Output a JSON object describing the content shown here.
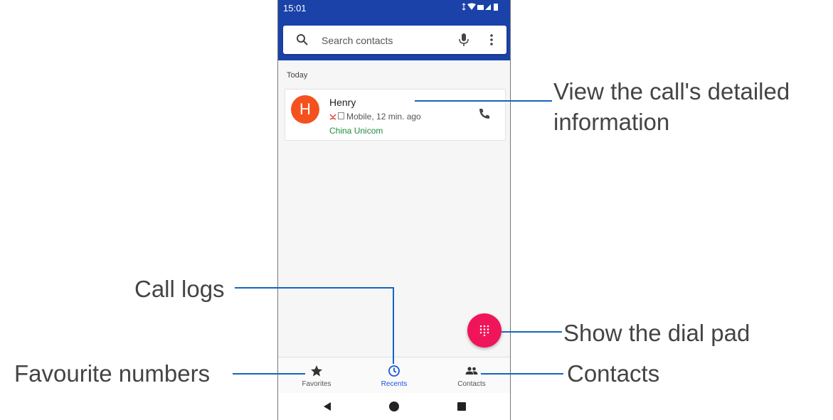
{
  "status_bar": {
    "time": "15:01",
    "icons": "▾▾▮▯▮"
  },
  "search": {
    "placeholder": "Search contacts"
  },
  "section": {
    "today_label": "Today"
  },
  "call_entry": {
    "avatar_letter": "H",
    "name": "Henry",
    "detail": "Mobile, 12 min. ago",
    "carrier": "China Unicom"
  },
  "bottom_nav": {
    "favorites": "Favorites",
    "recents": "Recents",
    "contacts": "Contacts"
  },
  "callouts": {
    "view_details_line1": "View the call's detailed",
    "view_details_line2": "information",
    "call_logs": "Call logs",
    "dial_pad": "Show the dial pad",
    "favourites": "Favourite numbers",
    "contacts": "Contacts"
  },
  "colors": {
    "header_blue": "#1a42a8",
    "accent_pink": "#f0145a",
    "avatar_orange": "#f4511e",
    "carrier_green": "#1e8e3e",
    "active_tab_blue": "#1a56e0",
    "callout_line_blue": "#1565c0"
  },
  "icons": [
    "search-icon",
    "mic-icon",
    "more-vert-icon",
    "missed-call-icon",
    "sim-icon",
    "phone-call-icon",
    "dialpad-icon",
    "star-icon",
    "clock-icon",
    "people-icon",
    "back-icon",
    "home-icon",
    "recent-apps-icon"
  ]
}
